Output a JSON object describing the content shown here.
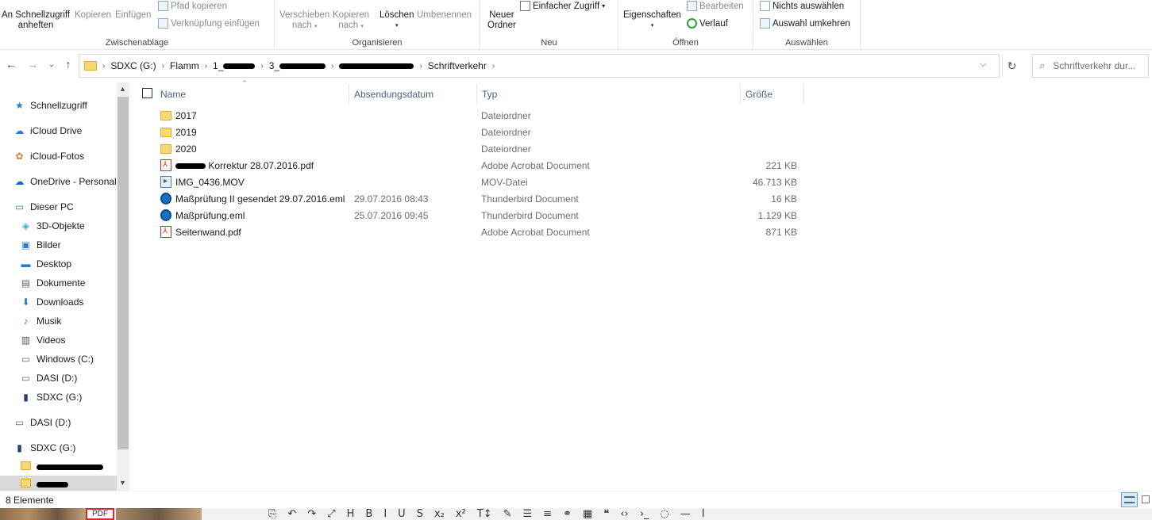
{
  "ribbon": {
    "clipboard": {
      "pin_line1": "An Schnellzugriff",
      "pin_line2": "anheften",
      "copy": "Kopieren",
      "paste": "Einfügen",
      "copy_path": "Pfad kopieren",
      "paste_shortcut": "Verknüpfung einfügen",
      "group_label": "Zwischenablage"
    },
    "organize": {
      "move_line1": "Verschieben",
      "move_line2": "nach",
      "copy_line1": "Kopieren",
      "copy_line2": "nach",
      "delete": "Löschen",
      "rename": "Umbenennen",
      "group_label": "Organisieren"
    },
    "new": {
      "new_folder_line1": "Neuer",
      "new_folder_line2": "Ordner",
      "easy_access": "Einfacher Zugriff",
      "group_label": "Neu"
    },
    "open": {
      "properties": "Eigenschaften",
      "edit": "Bearbeiten",
      "history": "Verlauf",
      "group_label": "Öffnen"
    },
    "select": {
      "select_none": "Nichts auswählen",
      "invert_selection": "Auswahl umkehren",
      "group_label": "Auswählen"
    }
  },
  "address": {
    "crumbs": [
      "SDXC (G:)",
      "Flamm",
      "1_",
      "3_",
      "",
      "Schriftverkehr"
    ],
    "search_placeholder": "Schriftverkehr dur..."
  },
  "nav": {
    "items": [
      {
        "label": "Schnellzugriff",
        "icon": "star-icon"
      },
      {
        "label": "iCloud Drive",
        "icon": "icloud-icon"
      },
      {
        "label": "iCloud-Fotos",
        "icon": "photos-icon"
      },
      {
        "label": "OneDrive - Personal",
        "icon": "onedrive-icon"
      },
      {
        "label": "Dieser PC",
        "icon": "pc-icon"
      },
      {
        "label": "3D-Objekte",
        "icon": "cube-icon"
      },
      {
        "label": "Bilder",
        "icon": "pictures-icon"
      },
      {
        "label": "Desktop",
        "icon": "desktop-icon"
      },
      {
        "label": "Dokumente",
        "icon": "documents-icon"
      },
      {
        "label": "Downloads",
        "icon": "download-icon"
      },
      {
        "label": "Musik",
        "icon": "music-icon"
      },
      {
        "label": "Videos",
        "icon": "video-icon"
      },
      {
        "label": "Windows (C:)",
        "icon": "drive-icon"
      },
      {
        "label": "DASI (D:)",
        "icon": "drive-icon"
      },
      {
        "label": "SDXC (G:)",
        "icon": "sd-card-icon"
      },
      {
        "label": "DASI (D:)",
        "icon": "drive-icon"
      },
      {
        "label": "SDXC (G:)",
        "icon": "sd-card-icon"
      }
    ]
  },
  "columns": {
    "name": "Name",
    "date": "Absendungsdatum",
    "type": "Typ",
    "size": "Größe"
  },
  "files": [
    {
      "name": "2017",
      "date": "",
      "type": "Dateiordner",
      "size": "",
      "icon": "folder"
    },
    {
      "name": "2019",
      "date": "",
      "type": "Dateiordner",
      "size": "",
      "icon": "folder"
    },
    {
      "name": "2020",
      "date": "",
      "type": "Dateiordner",
      "size": "",
      "icon": "folder"
    },
    {
      "name": "Korrektur 28.07.2016.pdf",
      "date": "",
      "type": "Adobe Acrobat Document",
      "size": "221 KB",
      "icon": "pdf"
    },
    {
      "name": "IMG_0436.MOV",
      "date": "",
      "type": "MOV-Datei",
      "size": "46.713 KB",
      "icon": "mov"
    },
    {
      "name": "Maßprüfung II gesendet 29.07.2016.eml",
      "date": "29.07.2016 08:43",
      "type": "Thunderbird Document",
      "size": "16 KB",
      "icon": "eml"
    },
    {
      "name": "Maßprüfung.eml",
      "date": "25.07.2016 09:45",
      "type": "Thunderbird Document",
      "size": "1.129 KB",
      "icon": "eml"
    },
    {
      "name": "Seitenwand.pdf",
      "date": "",
      "type": "Adobe Acrobat Document",
      "size": "871 KB",
      "icon": "pdf"
    }
  ],
  "status": {
    "count": "8 Elemente"
  },
  "taskbar": {
    "pdf_label": "PDF"
  },
  "colors": {
    "folder": "#f8d775",
    "accent": "#1b6fc2",
    "pdf_red": "#c9302c"
  }
}
